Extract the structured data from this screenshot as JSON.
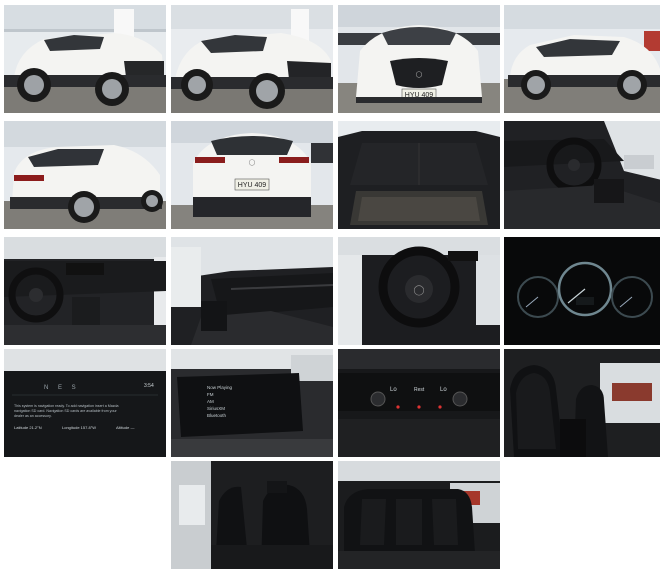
{
  "gallery": {
    "photos": [
      {
        "subject": "exterior-front-left"
      },
      {
        "subject": "exterior-front-left-close"
      },
      {
        "subject": "exterior-front"
      },
      {
        "subject": "exterior-side-right"
      },
      {
        "subject": "exterior-rear-left"
      },
      {
        "subject": "exterior-rear"
      },
      {
        "subject": "cargo-area"
      },
      {
        "subject": "driver-cockpit"
      },
      {
        "subject": "dashboard-wide"
      },
      {
        "subject": "passenger-dashboard"
      },
      {
        "subject": "steering-wheel"
      },
      {
        "subject": "instrument-cluster"
      },
      {
        "subject": "navigation-screen"
      },
      {
        "subject": "infotainment-screen"
      },
      {
        "subject": "climate-controls"
      },
      {
        "subject": "front-seats"
      },
      {
        "subject": "rear-seats-side"
      },
      {
        "subject": "rear-seats"
      }
    ],
    "plate_front": "HYU 409",
    "plate_rear": "HYU 409",
    "nav": {
      "compass": "N  E  S",
      "message1": "This system is navigation ready. To add navigation insert a Mazda",
      "message2": "navigation SD card. Navigation SD cards are available from your",
      "message3": "dealer as an accessory.",
      "lat": "Latitude  21.2°N",
      "lon": "Longitude  157.8°W",
      "alt": "Altitude  —",
      "clock": "3:54"
    },
    "menu": [
      "Now Playing",
      "FM",
      "AM",
      "SiriusXM",
      "Bluetooth"
    ],
    "climate": {
      "left": "Lo",
      "mid": "Rest",
      "right": "Lo"
    },
    "colors": {
      "body": "#f4f4f2",
      "dark": "#1d1e21",
      "floor": "#8b8a86"
    }
  }
}
